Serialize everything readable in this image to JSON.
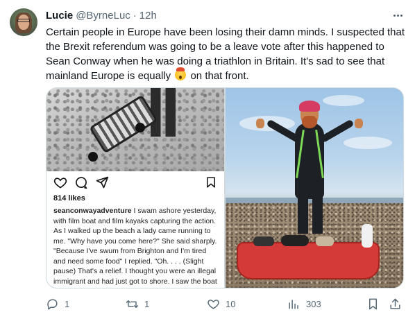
{
  "author": {
    "name": "Lucie",
    "handle": "@ByrneLuc",
    "separator": "·",
    "time": "12h"
  },
  "tweet": {
    "text_before_emoji": "Certain people in Europe have been losing their damn minds. I suspected that the Brexit referendum was going to be a leave vote after this happened to Sean Conway when he was doing a triathlon in Britain. It's sad to see that mainland Europe is equally",
    "emoji": "exploding-head-icon",
    "text_after_emoji": " on that front."
  },
  "media": {
    "left": {
      "likes": "814 likes",
      "caption_user": "seanconwayadventure",
      "caption_text": " I swam ashore yesterday, with film boat and film kayaks capturing the action. As I walked up the beach a lady came running to me. \"Why have you come here?\" She said sharply. \"Because I've swum from Brighton and I'm tired and need some food\" I replied. \"Oh. . . . (Slight pause) That's a relief. I thought you were an illegal immigrant and had just got to shore. I saw the boat and thought it was the"
    }
  },
  "actions": {
    "reply_count": "1",
    "retweet_count": "1",
    "like_count": "10",
    "view_count": "303"
  },
  "colors": {
    "text": "#0f1419",
    "secondary": "#536471",
    "border": "#cfd9de"
  }
}
